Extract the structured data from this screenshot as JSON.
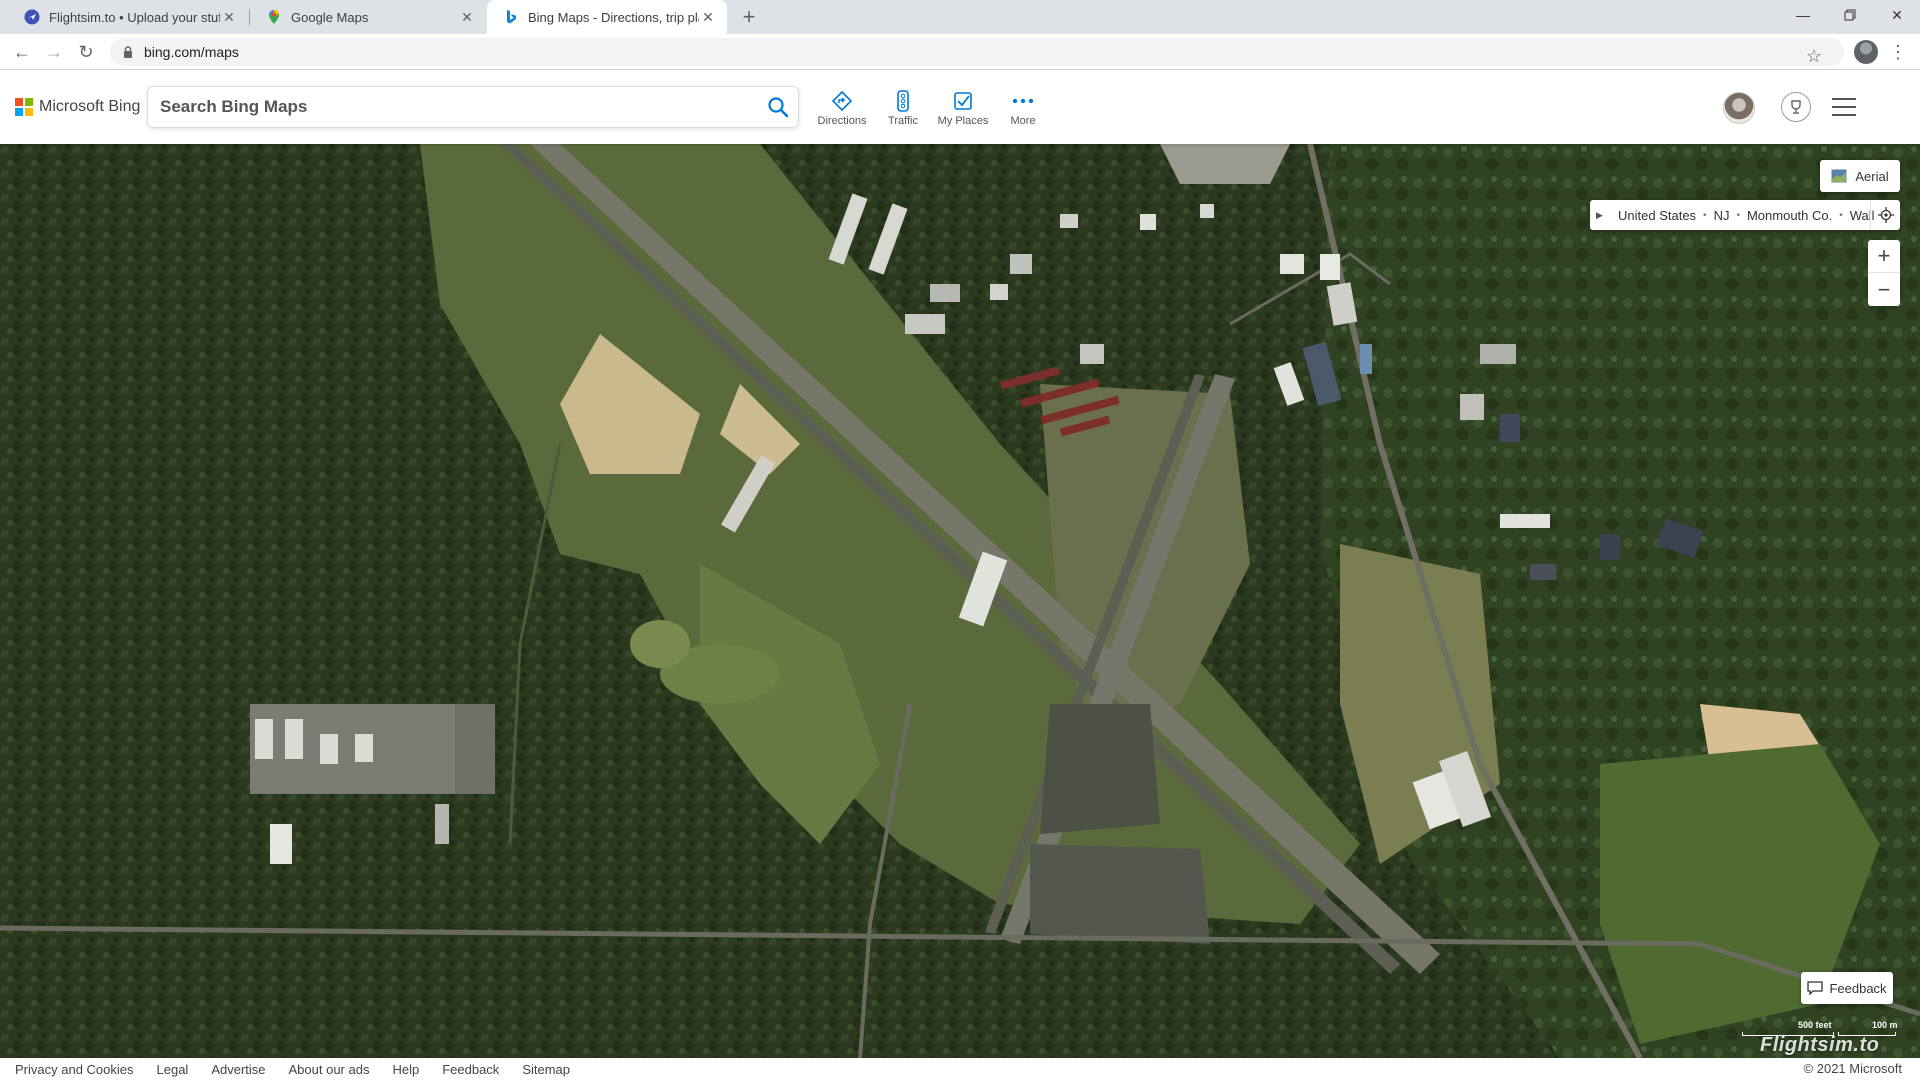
{
  "browser": {
    "tabs": [
      {
        "title": "Flightsim.to • Upload your stuff",
        "favicon": "flightsim-favicon",
        "active": false
      },
      {
        "title": "Google Maps",
        "favicon": "google-maps-favicon",
        "active": false
      },
      {
        "title": "Bing Maps - Directions, trip plann",
        "favicon": "bing-favicon",
        "active": true
      }
    ],
    "new_tab_icon": "plus-icon",
    "window_controls": [
      "minimize-icon",
      "restore-icon",
      "close-icon"
    ],
    "url": "bing.com/maps"
  },
  "bing": {
    "brand": "Microsoft Bing",
    "search_placeholder": "Search Bing Maps",
    "actions": [
      {
        "label": "Directions",
        "icon": "directions-icon"
      },
      {
        "label": "Traffic",
        "icon": "traffic-icon"
      },
      {
        "label": "My Places",
        "icon": "my-places-icon"
      },
      {
        "label": "More",
        "icon": "more-icon"
      }
    ],
    "accent_color": "#0078d4"
  },
  "map": {
    "style_button": "Aerial",
    "breadcrumb": [
      "United States",
      "NJ",
      "Monmouth Co.",
      "Wall"
    ],
    "zoom_in": "+",
    "zoom_out": "−",
    "feedback": "Feedback",
    "scale_feet": "500 feet",
    "scale_meters": "100 m",
    "watermark": "Flightsim.to"
  },
  "footer": {
    "links": [
      "Privacy and Cookies",
      "Legal",
      "Advertise",
      "About our ads",
      "Help",
      "Feedback",
      "Sitemap"
    ],
    "copyright": "© 2021 Microsoft"
  }
}
